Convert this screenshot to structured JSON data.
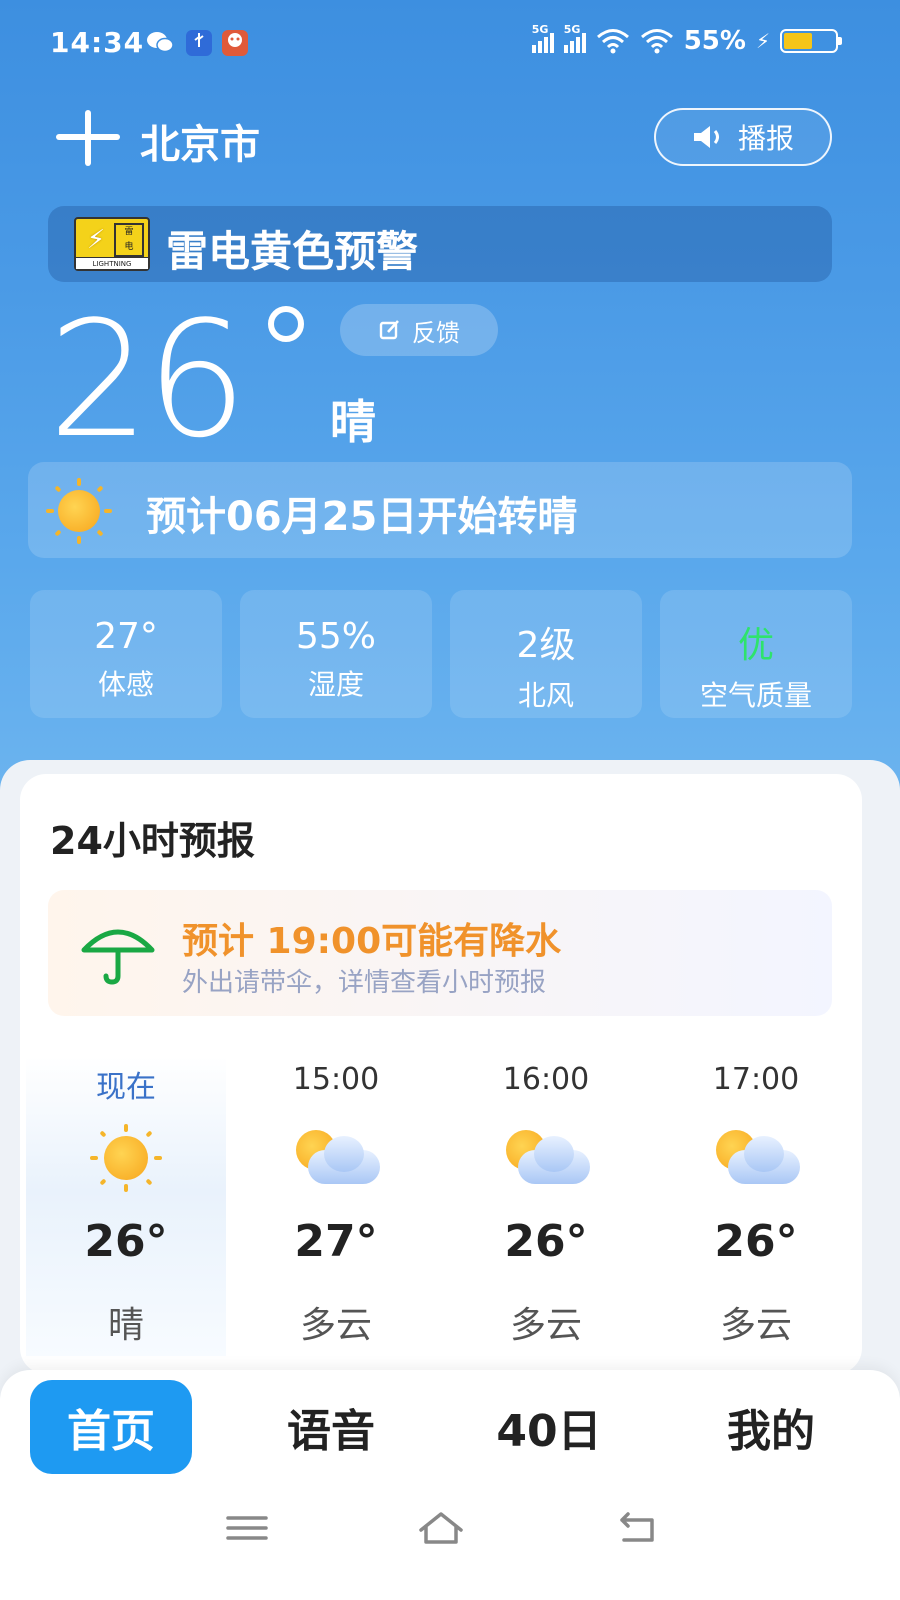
{
  "status_bar": {
    "time": "14:34",
    "battery": "55%",
    "battery_level": 0.55,
    "signal_label_1": "5G",
    "signal_label_2": "5G"
  },
  "header": {
    "city": "北京市",
    "broadcast_label": "播报"
  },
  "alert": {
    "text": "雷电黄色预警",
    "badge_text_1": "雷",
    "badge_text_2": "电",
    "badge_footer": "LIGHTNING"
  },
  "current": {
    "temperature": "26",
    "condition": "晴",
    "feedback_label": "反馈",
    "forecast_notice": "预计06月25日开始转晴"
  },
  "stats": [
    {
      "value": "27°",
      "label": "体感"
    },
    {
      "value": "55%",
      "label": "湿度"
    },
    {
      "value": "2级",
      "label": "北风"
    },
    {
      "value": "优",
      "label": "空气质量"
    }
  ],
  "hourly": {
    "title": "24小时预报",
    "rain_title": "预计 19:00可能有降水",
    "rain_subtitle": "外出请带伞，详情查看小时预报",
    "items": [
      {
        "time": "现在",
        "temp": "26°",
        "cond": "晴",
        "icon": "sun-icon"
      },
      {
        "time": "15:00",
        "temp": "27°",
        "cond": "多云",
        "icon": "partly-cloudy-icon"
      },
      {
        "time": "16:00",
        "temp": "26°",
        "cond": "多云",
        "icon": "partly-cloudy-icon"
      },
      {
        "time": "17:00",
        "temp": "26°",
        "cond": "多云",
        "icon": "partly-cloudy-icon"
      }
    ]
  },
  "nav": {
    "home": "首页",
    "voice": "语音",
    "forty_day": "40日",
    "mine": "我的"
  },
  "colors": {
    "accent": "#1e9af2",
    "rain_orange": "#f0922b",
    "air_good_green": "#2ee36c"
  }
}
